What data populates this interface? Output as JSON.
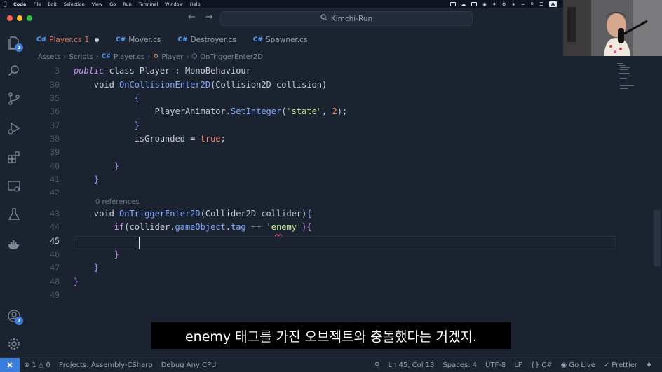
{
  "menubar": {
    "app": "Code",
    "items": [
      "File",
      "Edit",
      "Selection",
      "View",
      "Go",
      "Run",
      "Terminal",
      "Window",
      "Help"
    ],
    "input_source": "A"
  },
  "titlebar": {
    "search_text": "Kimchi-Run"
  },
  "activity": {
    "explorer_badge": "1",
    "accounts_badge": "1"
  },
  "tabs": [
    {
      "icon": "C#",
      "label": "Player.cs",
      "modified_count": "1"
    },
    {
      "icon": "C#",
      "label": "Mover.cs"
    },
    {
      "icon": "C#",
      "label": "Destroyer.cs"
    },
    {
      "icon": "C#",
      "label": "Spawner.cs"
    }
  ],
  "breadcrumb": {
    "items": [
      "Assets",
      "Scripts",
      "Player.cs",
      "Player",
      "OnTriggerEnter2D"
    ],
    "file_icon": "C#"
  },
  "editor": {
    "lines": [
      {
        "num": "3",
        "tokens": [
          {
            "t": "public",
            "c": "k-it"
          },
          {
            "t": " class Player : MonoBehaviour",
            "c": "k"
          }
        ]
      },
      {
        "num": "30",
        "tokens": [
          {
            "t": "    void ",
            "c": "k"
          },
          {
            "t": "OnCollisionEnter2D",
            "c": "fn"
          },
          {
            "t": "(Collision2D collision)",
            "c": "k"
          }
        ]
      },
      {
        "num": "35",
        "tokens": [
          {
            "t": "            {",
            "c": "br"
          }
        ]
      },
      {
        "num": "36",
        "tokens": [
          {
            "t": "                PlayerAnimator.",
            "c": "k"
          },
          {
            "t": "SetInteger",
            "c": "fn"
          },
          {
            "t": "(",
            "c": "k"
          },
          {
            "t": "\"state\"",
            "c": "str"
          },
          {
            "t": ", ",
            "c": "k"
          },
          {
            "t": "2",
            "c": "num"
          },
          {
            "t": ");",
            "c": "k"
          }
        ]
      },
      {
        "num": "37",
        "tokens": [
          {
            "t": "            }",
            "c": "br"
          }
        ]
      },
      {
        "num": "38",
        "tokens": [
          {
            "t": "            isGrounded = ",
            "c": "k"
          },
          {
            "t": "true",
            "c": "kw2"
          },
          {
            "t": ";",
            "c": "k"
          }
        ]
      },
      {
        "num": "39",
        "tokens": []
      },
      {
        "num": "40",
        "tokens": [
          {
            "t": "        }",
            "c": "br2"
          }
        ]
      },
      {
        "num": "41",
        "tokens": [
          {
            "t": "    }",
            "c": "br"
          }
        ]
      },
      {
        "num": "42",
        "tokens": []
      },
      {
        "num": "43",
        "tokens": [
          {
            "t": "    void ",
            "c": "k"
          },
          {
            "t": "OnTriggerEnter2D",
            "c": "fn"
          },
          {
            "t": "(Collider2D collider)",
            "c": "k"
          },
          {
            "t": "{",
            "c": "br"
          }
        ]
      },
      {
        "num": "44",
        "tokens": [
          {
            "t": "        if",
            "c": "br2"
          },
          {
            "t": "(collider.",
            "c": "k"
          },
          {
            "t": "gameObject",
            "c": "fn"
          },
          {
            "t": ".",
            "c": "k"
          },
          {
            "t": "tag",
            "c": "fn"
          },
          {
            "t": " == ",
            "c": "k"
          },
          {
            "t": "'enemy'",
            "c": "str"
          },
          {
            "t": "){",
            "c": "br2"
          }
        ]
      },
      {
        "num": "45",
        "tokens": []
      },
      {
        "num": "46",
        "tokens": [
          {
            "t": "        }",
            "c": "br2"
          }
        ]
      },
      {
        "num": "47",
        "tokens": [
          {
            "t": "    }",
            "c": "br"
          }
        ]
      },
      {
        "num": "48",
        "tokens": [
          {
            "t": "}",
            "c": "br2"
          }
        ]
      },
      {
        "num": "49",
        "tokens": []
      }
    ],
    "codelens": "0 references"
  },
  "subtitle": "enemy 태그를 가진 오브젝트와 충돌했다는 거겠지.",
  "statusbar": {
    "errors": "1",
    "warnings": "0",
    "project": "Projects: Assembly-CSharp",
    "debug": "Debug Any CPU",
    "position": "Ln 45, Col 13",
    "spaces": "Spaces: 4",
    "encoding": "UTF-8",
    "eol": "LF",
    "language": "C#",
    "golive": "Go Live",
    "prettier": "Prettier"
  }
}
